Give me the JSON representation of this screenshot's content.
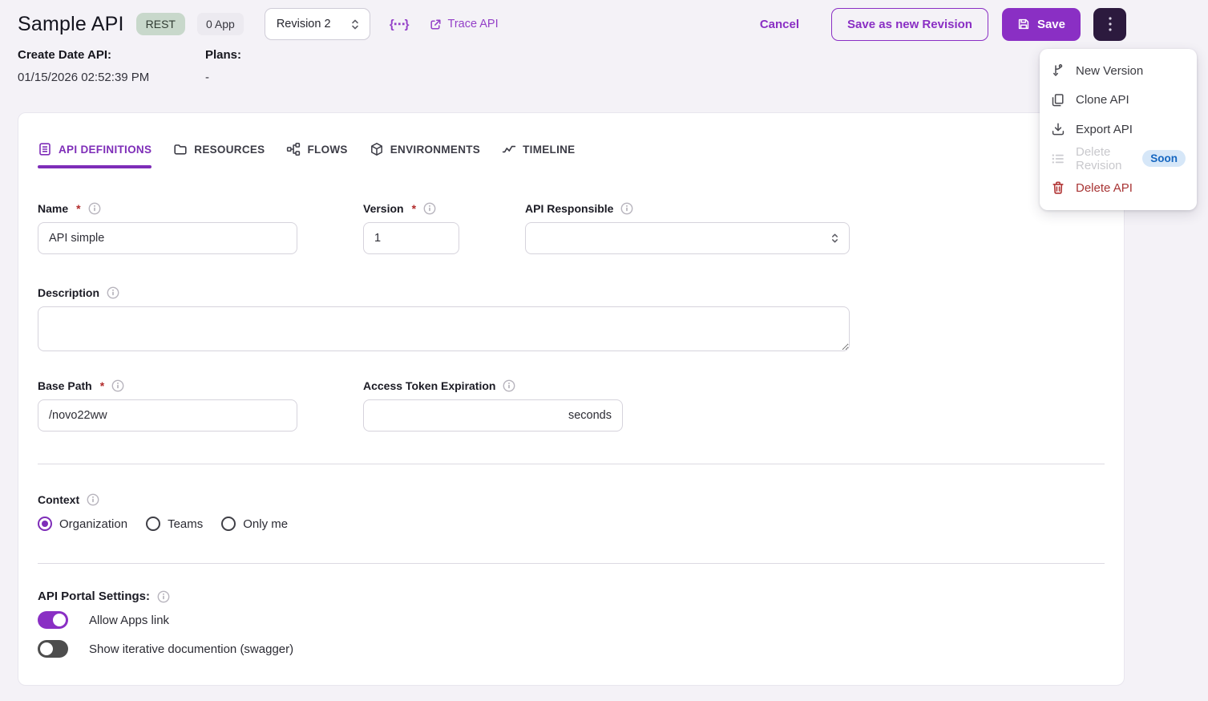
{
  "header": {
    "title": "Sample API",
    "rest_badge": "REST",
    "app_badge": "0 App",
    "revision_select_value": "Revision 2",
    "code_icon_glyph": "{⋯}",
    "trace_api_label": "Trace API",
    "cancel_label": "Cancel",
    "save_as_new_revision_label": "Save as new Revision",
    "save_label": "Save",
    "meta": {
      "create_date_label": "Create Date API:",
      "create_date_value": "01/15/2026 02:52:39 PM",
      "plans_label": "Plans:",
      "plans_value": "-"
    }
  },
  "menu": {
    "items": [
      {
        "label": "New Version",
        "icon": "branch-icon",
        "disabled": false
      },
      {
        "label": "Clone API",
        "icon": "clone-icon",
        "disabled": false
      },
      {
        "label": "Export API",
        "icon": "download-icon",
        "disabled": false
      },
      {
        "label": "Delete Revision",
        "icon": "list-icon",
        "disabled": true,
        "badge": "Soon"
      },
      {
        "label": "Delete API",
        "icon": "trash-icon",
        "disabled": false,
        "danger": true
      }
    ]
  },
  "tabs": [
    {
      "label": "API DEFINITIONS",
      "icon": "document-icon",
      "active": true
    },
    {
      "label": "RESOURCES",
      "icon": "folder-icon",
      "active": false
    },
    {
      "label": "FLOWS",
      "icon": "flow-icon",
      "active": false
    },
    {
      "label": "ENVIRONMENTS",
      "icon": "package-icon",
      "active": false
    },
    {
      "label": "TIMELINE",
      "icon": "trend-icon",
      "active": false
    }
  ],
  "ui": {
    "required_mark": "*"
  },
  "form": {
    "name": {
      "label": "Name",
      "required": true,
      "value": "API simple"
    },
    "version": {
      "label": "Version",
      "required": true,
      "value": "1"
    },
    "api_responsible": {
      "label": "API Responsible",
      "value": ""
    },
    "description": {
      "label": "Description",
      "value": ""
    },
    "base_path": {
      "label": "Base Path",
      "required": true,
      "value": "/novo22ww"
    },
    "access_token_expiration": {
      "label": "Access Token Expiration",
      "value": "",
      "suffix": "seconds"
    },
    "context": {
      "label": "Context",
      "options": [
        {
          "label": "Organization",
          "selected": true
        },
        {
          "label": "Teams",
          "selected": false
        },
        {
          "label": "Only me",
          "selected": false
        }
      ]
    },
    "portal_settings": {
      "label": "API Portal Settings:",
      "toggles": [
        {
          "label": "Allow Apps link",
          "on": true
        },
        {
          "label": "Show iterative documention (swagger)",
          "on": false
        }
      ]
    }
  },
  "colors": {
    "accent": "#8A2FC4",
    "link": "#9440C8",
    "dark_button_bg": "#2C1A3E",
    "danger": "#A83434",
    "rest_badge_bg": "#C8D8CB",
    "app_badge_bg": "#ECEAF0",
    "soon_badge_bg": "#D6E7F8",
    "soon_badge_text": "#1566C0",
    "page_bg": "#F4F2F7"
  }
}
